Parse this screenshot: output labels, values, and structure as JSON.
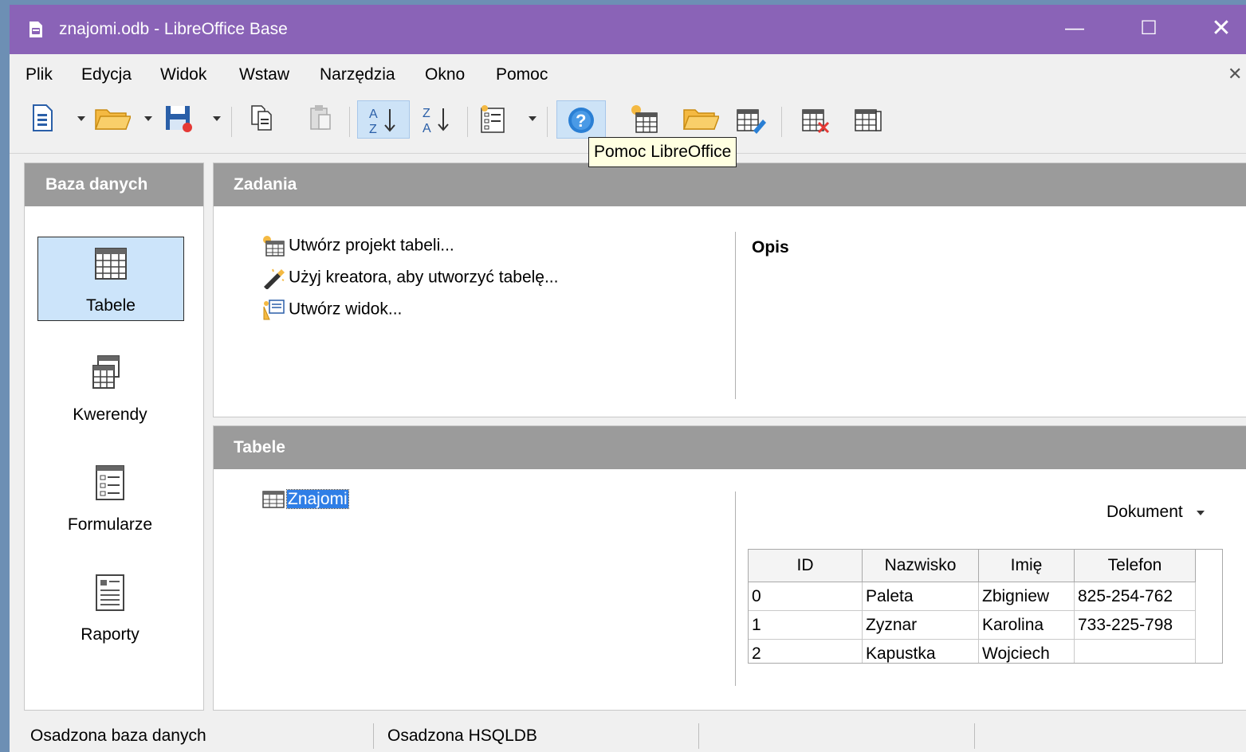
{
  "window": {
    "title": "znajomi.odb - LibreOffice Base",
    "controls": {
      "minimize": "—",
      "maximize": "☐",
      "close": "✕"
    }
  },
  "menubar": {
    "items": [
      {
        "label": "Plik"
      },
      {
        "label": "Edycja"
      },
      {
        "label": "Widok"
      },
      {
        "label": "Wstaw"
      },
      {
        "label": "Narzędzia"
      },
      {
        "label": "Okno"
      },
      {
        "label": "Pomoc"
      }
    ],
    "close_doc": "✕"
  },
  "toolbar": {
    "buttons": [
      "new-document-icon",
      "open-folder-icon",
      "save-icon",
      "copy-icon",
      "paste-icon",
      "sort-ascending-icon",
      "sort-descending-icon",
      "form-view-icon",
      "help-icon",
      "new-table-icon",
      "open-object-icon",
      "edit-table-icon",
      "delete-table-icon",
      "table-properties-icon"
    ],
    "tooltip": "Pomoc LibreOffice"
  },
  "left_panel": {
    "header": "Baza danych",
    "items": [
      {
        "label": "Tabele",
        "icon": "table-icon",
        "selected": true
      },
      {
        "label": "Kwerendy",
        "icon": "query-icon",
        "selected": false
      },
      {
        "label": "Formularze",
        "icon": "form-icon",
        "selected": false
      },
      {
        "label": "Raporty",
        "icon": "report-icon",
        "selected": false
      }
    ]
  },
  "tasks_panel": {
    "header": "Zadania",
    "items": [
      {
        "label": "Utwórz projekt tabeli...",
        "icon": "table-design-icon"
      },
      {
        "label": "Użyj kreatora, aby utworzyć tabelę...",
        "icon": "wizard-wand-icon"
      },
      {
        "label": "Utwórz widok...",
        "icon": "create-view-icon"
      }
    ],
    "description_label": "Opis"
  },
  "tables_panel": {
    "header": "Tabele",
    "table_name": "Znajomi",
    "preview_mode": "Dokument",
    "preview": {
      "columns": [
        "ID",
        "Nazwisko",
        "Imię",
        "Telefon"
      ],
      "rows": [
        [
          "0",
          "Paleta",
          "Zbigniew",
          "825-254-762"
        ],
        [
          "1",
          "Zyznar",
          "Karolina",
          "733-225-798"
        ],
        [
          "2",
          "Kapustka",
          "Wojciech",
          ""
        ]
      ]
    }
  },
  "statusbar": {
    "fields": [
      "Osadzona baza danych",
      "Osadzona HSQLDB"
    ]
  },
  "colors": {
    "titlebar": "#8a63b7",
    "panel_header": "#9b9b9b",
    "selection": "#2f7ee6",
    "nav_selected": "#cce4fa"
  }
}
